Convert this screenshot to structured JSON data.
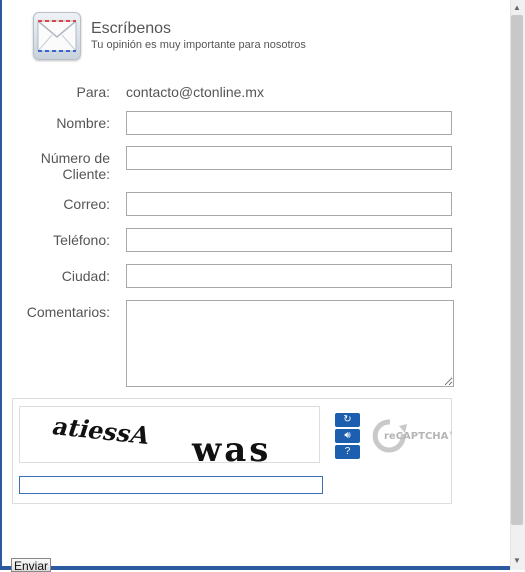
{
  "header": {
    "title": "Escríbenos",
    "subtitle": "Tu opinión es muy importante para nosotros",
    "icon": "mail-envelope-icon"
  },
  "form": {
    "to_label": "Para:",
    "to_value": "contacto@ctonline.mx",
    "name_label": "Nombre:",
    "name_value": "",
    "client_number_label_line1": "Número de",
    "client_number_label_line2": "Cliente:",
    "client_number_value": "",
    "email_label": "Correo:",
    "email_value": "",
    "phone_label": "Teléfono:",
    "phone_value": "",
    "city_label": "Ciudad:",
    "city_value": "",
    "comments_label": "Comentarios:",
    "comments_value": ""
  },
  "captcha": {
    "word1": "atiessA",
    "word2": "was",
    "logo_text": "reCAPTCHA™",
    "buttons": [
      "refresh-icon",
      "audio-icon",
      "help-icon"
    ],
    "input_value": ""
  },
  "submit_label": "Enviar",
  "colors": {
    "accent": "#1c5fae",
    "frame": "#2b5aa0",
    "text": "#555555"
  }
}
